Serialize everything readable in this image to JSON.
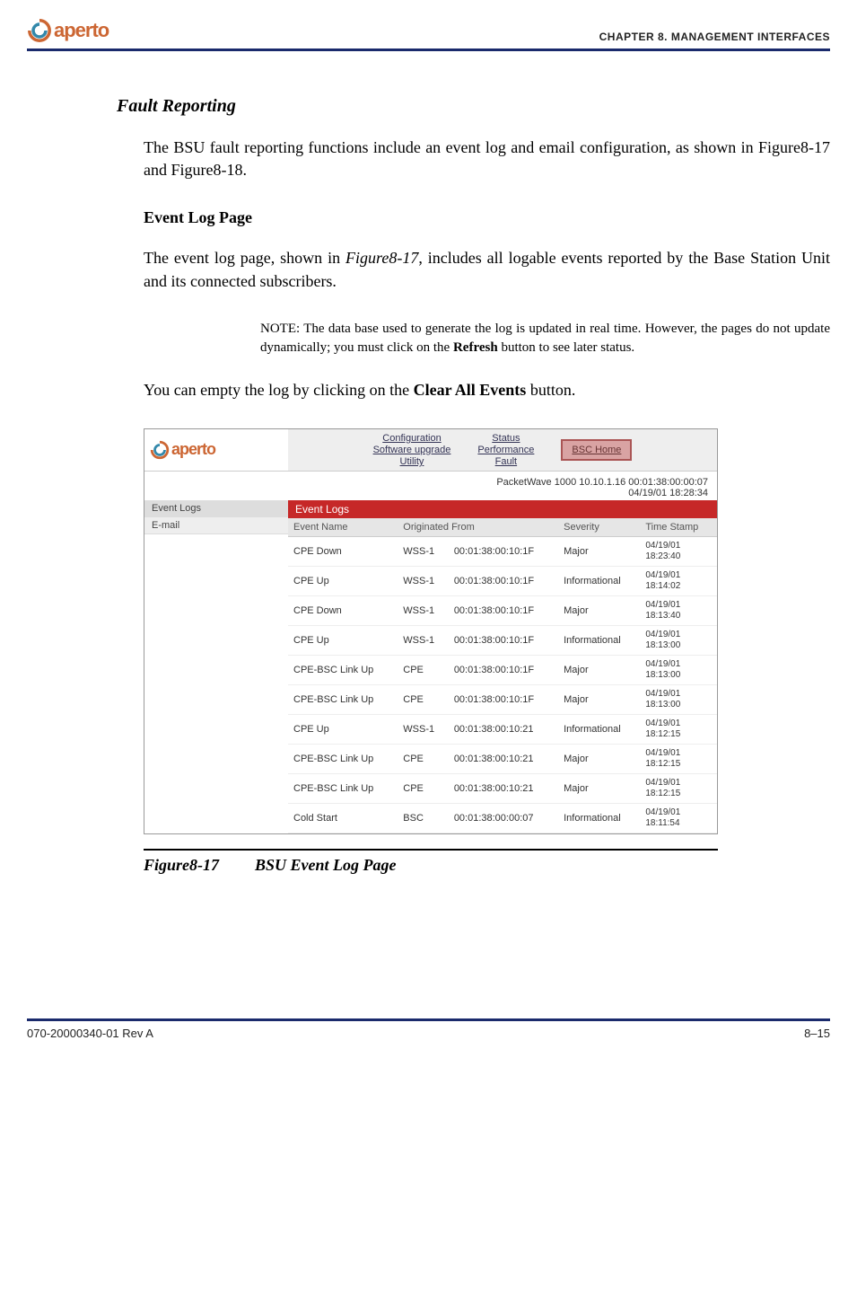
{
  "header": {
    "logo_text_1": "aperto",
    "chapter": "CHAPTER 8.  MANAGEMENT INTERFACES"
  },
  "doc": {
    "section_title": "Fault Reporting",
    "intro": "The BSU fault reporting functions include an event log and email configuration, as shown in Figure8-17 and Figure8-18.",
    "sub_title": "Event Log Page",
    "para1_a": "The event log page, shown in ",
    "para1_ref": "Figure8-17",
    "para1_b": ", includes all logable events reported by the Base Station Unit and its connected subscribers.",
    "note_lead": "NOTE:  ",
    "note_a": "The data base used to generate the log is updated in real time. However, the pages do not update dynamically; you must click on the ",
    "note_bold": "Refresh",
    "note_b": " button to see later status.",
    "para2_a": "You can empty the log by clicking on the ",
    "para2_bold": "Clear All Events",
    "para2_b": " button.",
    "fig_num": "Figure8-17",
    "fig_title": "BSU Event Log Page"
  },
  "screenshot": {
    "nav": {
      "col1": [
        "Configuration",
        "Software upgrade",
        "Utility"
      ],
      "col2": [
        "Status",
        "Performance",
        "Fault"
      ],
      "home": "BSC Home"
    },
    "device_line1": "PacketWave 1000    10.10.1.16    00:01:38:00:00:07",
    "device_line2": "04/19/01    18:28:34",
    "sidebar": [
      "Event Logs",
      "E-mail"
    ],
    "panel_title": "Event Logs",
    "columns": [
      "Event Name",
      "Originated From",
      "Severity",
      "Time Stamp"
    ],
    "rows": [
      {
        "event": "CPE Down",
        "src": "WSS-1",
        "mac": "00:01:38:00:10:1F",
        "sev": "Major",
        "ts": "04/19/01\n18:23:40"
      },
      {
        "event": "CPE Up",
        "src": "WSS-1",
        "mac": "00:01:38:00:10:1F",
        "sev": "Informational",
        "ts": "04/19/01\n18:14:02"
      },
      {
        "event": "CPE Down",
        "src": "WSS-1",
        "mac": "00:01:38:00:10:1F",
        "sev": "Major",
        "ts": "04/19/01\n18:13:40"
      },
      {
        "event": "CPE Up",
        "src": "WSS-1",
        "mac": "00:01:38:00:10:1F",
        "sev": "Informational",
        "ts": "04/19/01\n18:13:00"
      },
      {
        "event": "CPE-BSC Link Up",
        "src": "CPE",
        "mac": "00:01:38:00:10:1F",
        "sev": "Major",
        "ts": "04/19/01\n18:13:00"
      },
      {
        "event": "CPE-BSC Link Up",
        "src": "CPE",
        "mac": "00:01:38:00:10:1F",
        "sev": "Major",
        "ts": "04/19/01\n18:13:00"
      },
      {
        "event": "CPE Up",
        "src": "WSS-1",
        "mac": "00:01:38:00:10:21",
        "sev": "Informational",
        "ts": "04/19/01\n18:12:15"
      },
      {
        "event": "CPE-BSC Link Up",
        "src": "CPE",
        "mac": "00:01:38:00:10:21",
        "sev": "Major",
        "ts": "04/19/01\n18:12:15"
      },
      {
        "event": "CPE-BSC Link Up",
        "src": "CPE",
        "mac": "00:01:38:00:10:21",
        "sev": "Major",
        "ts": "04/19/01\n18:12:15"
      },
      {
        "event": "Cold Start",
        "src": "BSC",
        "mac": "00:01:38:00:00:07",
        "sev": "Informational",
        "ts": "04/19/01\n18:11:54"
      }
    ]
  },
  "footer": {
    "doc_num": "070-20000340-01 Rev A",
    "page_num": "8–15"
  }
}
